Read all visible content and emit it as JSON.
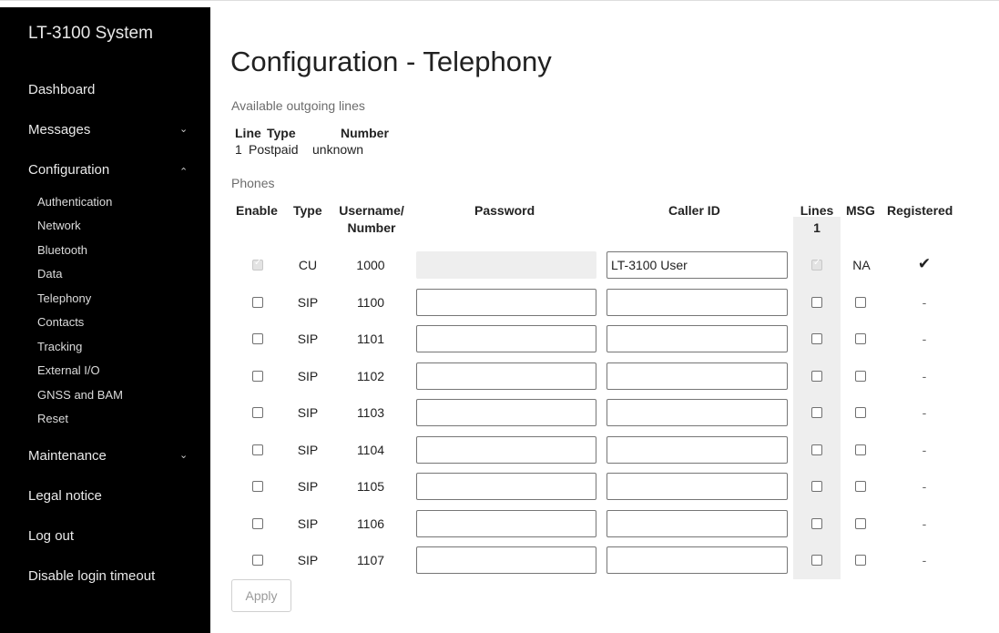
{
  "sidebar": {
    "brand": "LT-3100 System",
    "items": [
      {
        "label": "Dashboard"
      },
      {
        "label": "Messages",
        "caret": "⌄"
      },
      {
        "label": "Configuration",
        "caret": "⌃"
      },
      {
        "label": "Maintenance",
        "caret": "⌄"
      },
      {
        "label": "Legal notice"
      },
      {
        "label": "Log out"
      },
      {
        "label": "Disable login timeout"
      }
    ],
    "config_sub": [
      "Authentication",
      "Network",
      "Bluetooth",
      "Data",
      "Telephony",
      "Contacts",
      "Tracking",
      "External I/O",
      "GNSS and BAM",
      "Reset"
    ]
  },
  "page": {
    "title": "Configuration - Telephony",
    "outgoing_label": "Available outgoing lines",
    "outgoing_headers": {
      "line": "Line",
      "type": "Type",
      "number": "Number"
    },
    "outgoing_row": {
      "line": "1",
      "type": "Postpaid",
      "number": "unknown"
    },
    "phones_label": "Phones",
    "phone_headers": {
      "enable": "Enable",
      "type": "Type",
      "username": "Username/",
      "number": "Number",
      "password": "Password",
      "caller_id": "Caller ID",
      "lines": "Lines",
      "lines_sub": "1",
      "msg": "MSG",
      "registered": "Registered"
    },
    "phones": [
      {
        "enable": true,
        "type": "CU",
        "number": "1000",
        "caller_id": "LT-3100 User",
        "registered": "✔",
        "msg": "NA",
        "disabled": true
      },
      {
        "type": "SIP",
        "number": "1100",
        "registered": "-"
      },
      {
        "type": "SIP",
        "number": "1101",
        "registered": "-"
      },
      {
        "type": "SIP",
        "number": "1102",
        "registered": "-"
      },
      {
        "type": "SIP",
        "number": "1103",
        "registered": "-"
      },
      {
        "type": "SIP",
        "number": "1104",
        "registered": "-"
      },
      {
        "type": "SIP",
        "number": "1105",
        "registered": "-"
      },
      {
        "type": "SIP",
        "number": "1106",
        "registered": "-"
      },
      {
        "type": "SIP",
        "number": "1107",
        "registered": "-"
      }
    ],
    "apply_label": "Apply"
  }
}
